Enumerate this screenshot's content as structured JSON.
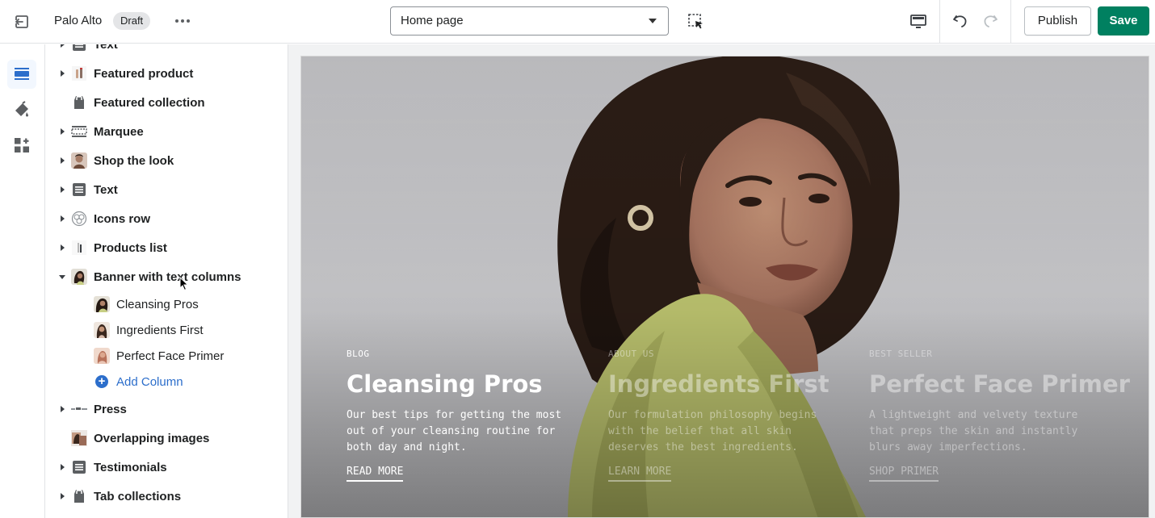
{
  "topbar": {
    "store_name": "Palo Alto",
    "status_badge": "Draft",
    "page_select": "Home page",
    "publish_label": "Publish",
    "save_label": "Save",
    "icons": [
      "exit-icon",
      "more-icon",
      "inspect-icon",
      "desktop-icon",
      "undo-icon",
      "redo-icon"
    ]
  },
  "rail": {
    "items": [
      "sections-icon",
      "theme-settings-icon",
      "app-embeds-icon"
    ]
  },
  "sidebar": {
    "sections": [
      {
        "label": "Text",
        "expandable": true
      },
      {
        "label": "Featured product",
        "expandable": true
      },
      {
        "label": "Featured collection",
        "expandable": false
      },
      {
        "label": "Marquee",
        "expandable": true
      },
      {
        "label": "Shop the look",
        "expandable": true
      },
      {
        "label": "Text",
        "expandable": true
      },
      {
        "label": "Icons row",
        "expandable": true
      },
      {
        "label": "Products list",
        "expandable": true
      },
      {
        "label": "Banner with text columns",
        "expandable": true,
        "expanded": true
      },
      {
        "label": "Press",
        "expandable": true
      },
      {
        "label": "Overlapping images",
        "expandable": false
      },
      {
        "label": "Testimonials",
        "expandable": true
      },
      {
        "label": "Tab collections",
        "expandable": true
      }
    ],
    "banner_blocks": [
      {
        "label": "Cleansing Pros"
      },
      {
        "label": "Ingredients First"
      },
      {
        "label": "Perfect Face Primer"
      }
    ],
    "add_column_label": "Add Column"
  },
  "preview": {
    "columns": [
      {
        "eyebrow": "BLOG",
        "heading": "Cleansing Pros",
        "body": "Our best tips for getting the most out of your cleansing routine for both day and night.",
        "cta": "READ MORE"
      },
      {
        "eyebrow": "ABOUT US",
        "heading": "Ingredients First",
        "body": "Our formulation philosophy begins with the belief that all skin deserves the best ingredients.",
        "cta": "LEARN MORE"
      },
      {
        "eyebrow": "BEST SELLER",
        "heading": "Perfect Face Primer",
        "body": "A lightweight and velvety texture that preps the skin and instantly blurs away imperfections.",
        "cta": "SHOP PRIMER"
      }
    ]
  },
  "colors": {
    "primary": "#008060",
    "link": "#2c6ecb",
    "active_rail": "#2c6ecb"
  }
}
